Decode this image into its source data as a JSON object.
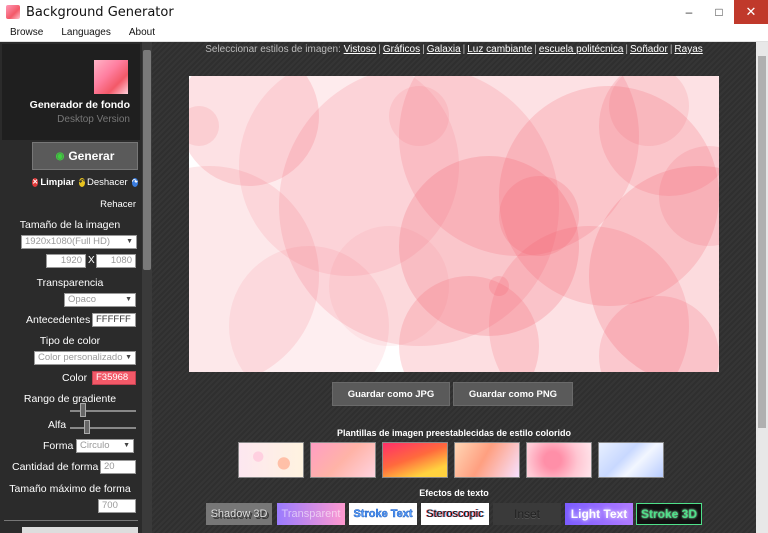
{
  "window": {
    "title": "Background Generator",
    "minimize": "–",
    "maximize": "□",
    "close": "✕"
  },
  "menu": [
    "Browse",
    "Languages",
    "About"
  ],
  "sidebar": {
    "app_name": "Generador de fondo",
    "app_version": "Desktop Version",
    "generate": "Generar",
    "clear": "Limpiar",
    "undo": "Deshacer",
    "redo": "Rehacer",
    "image_size_label": "Tamaño de la imagen",
    "image_size_value": "1920x1080(Full HD)",
    "width": "1920",
    "x_label": "X",
    "height": "1080",
    "transparency_label": "Transparencia",
    "transparency_value": "Opaco",
    "background_label": "Antecedentes",
    "background_value": "FFFFFF",
    "color_type_label": "Tipo de color",
    "color_type_value": "Color personalizado",
    "color_label": "Color",
    "color_value": "F35968",
    "gradient_label": "Rango de gradiente",
    "alpha_label": "Alfa",
    "shape_label": "Forma",
    "shape_value": "Circulo",
    "shape_count_label": "Cantidad de forma",
    "shape_count_value": "20",
    "max_size_label": "Tamaño máximo de forma",
    "max_size_value": "700"
  },
  "main": {
    "styles_prefix": "Seleccionar estilos de imagen:",
    "styles": [
      "Vistoso",
      "Gráficos",
      "Galaxia",
      "Luz cambiante",
      "escuela politécnica",
      "Soñador",
      "Rayas"
    ],
    "save_jpg": "Guardar como JPG",
    "save_png": "Guardar como PNG",
    "templates_title": "Plantillas de imagen preestablecidas de estilo colorido",
    "text_effects_title": "Efectos de texto",
    "effects": [
      "Shadow 3D",
      "Transparent",
      "Stroke Text",
      "Steroscopic",
      "Inset",
      "Light Text",
      "Stroke 3D"
    ]
  },
  "colors": {
    "accent": "#F35968",
    "sidebar_bg": "#2b2b2b",
    "main_bg": "#333333"
  }
}
